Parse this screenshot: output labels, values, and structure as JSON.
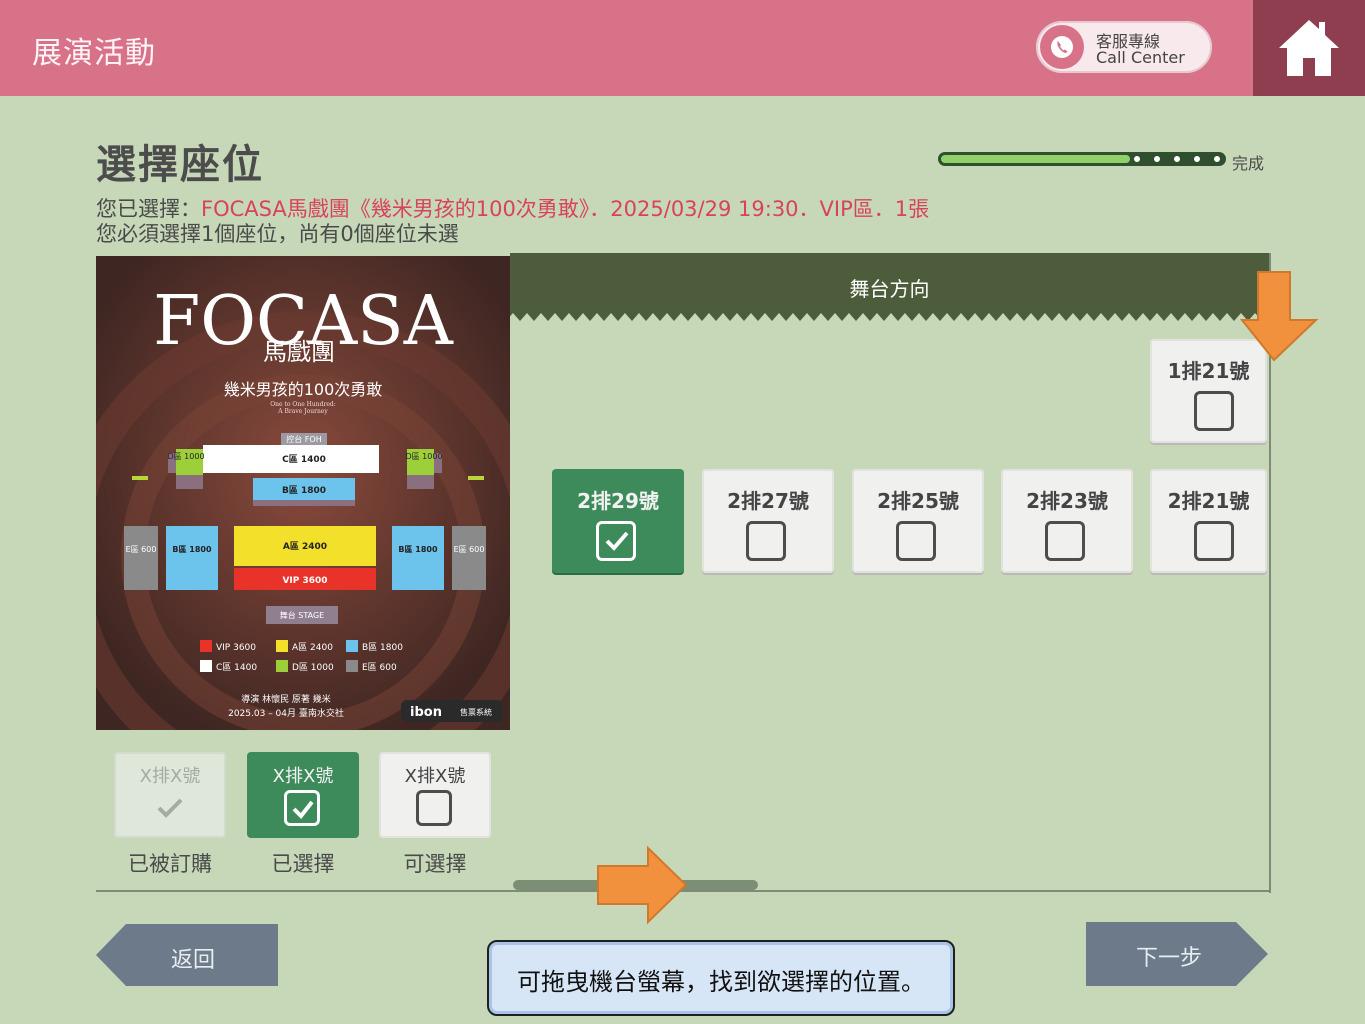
{
  "header": {
    "title": "展演活動",
    "call_center_cn": "客服專線",
    "call_center_en": "Call Center",
    "home_icon": "home-icon",
    "phone_icon": "phone-icon"
  },
  "page": {
    "title": "選擇座位",
    "progress_label": "完成",
    "progress_value": 0.67,
    "selection_prefix": "您已選擇：",
    "selection_detail": "FOCASA馬戲團《幾米男孩的100次勇敢》．2025/03/29 19:30．VIP區．1張",
    "requirement": "您必須選擇1個座位，尚有0個座位未選"
  },
  "poster": {
    "brand": "FOCASA",
    "brand_sub": "馬戲團",
    "show_title": "幾米男孩的100次勇敢",
    "show_subtitle_en_1": "One to One Hundred:",
    "show_subtitle_en_2": "A Brave Journey",
    "foh": "控台 FOH",
    "zones": {
      "c": "C區 1400",
      "b_center": "B區 1800",
      "a": "A區 2400",
      "vip": "VIP 3600",
      "d_left": "D區 1000",
      "d_right": "D區 1000",
      "b_left": "B區 1800",
      "b_right": "B區 1800",
      "e_left": "E區 600",
      "e_right": "E區 600",
      "stage": "舞台 STAGE"
    },
    "legend": [
      "VIP 3600",
      "A區 2400",
      "B區 1800",
      "C區 1400",
      "D區 1000",
      "E區 600"
    ],
    "legend_colors": [
      "#e8322a",
      "#f3e02b",
      "#6cc4ec",
      "#ffffff",
      "#9ccf3a",
      "#8a8a8a"
    ],
    "credit_1": "導演 林懷民  原著 幾米",
    "credit_2": "2025.03 – 04月 臺南水交社",
    "ibon": "ibon",
    "ibon_sub": "售票系統"
  },
  "seat_map": {
    "stage_direction": "舞台方向",
    "row1": [
      {
        "label": "1排21號",
        "selected": false
      }
    ],
    "row2": [
      {
        "label": "2排29號",
        "selected": true
      },
      {
        "label": "2排27號",
        "selected": false
      },
      {
        "label": "2排25號",
        "selected": false
      },
      {
        "label": "2排23號",
        "selected": false
      },
      {
        "label": "2排21號",
        "selected": false
      }
    ]
  },
  "legend": [
    {
      "seat": "X排X號",
      "caption": "已被訂購",
      "state": "booked"
    },
    {
      "seat": "X排X號",
      "caption": "已選擇",
      "state": "selected"
    },
    {
      "seat": "X排X號",
      "caption": "可選擇",
      "state": "available"
    }
  ],
  "nav": {
    "back": "返回",
    "next": "下一步"
  },
  "tip": "可拖曳機台螢幕，找到欲選擇的位置。",
  "colors": {
    "header": "#d87289",
    "home": "#8e3e4e",
    "background": "#c6d8b8",
    "selected_seat": "#3d8a5a",
    "accent_red": "#d9435a",
    "arrow": "#f2913d"
  }
}
